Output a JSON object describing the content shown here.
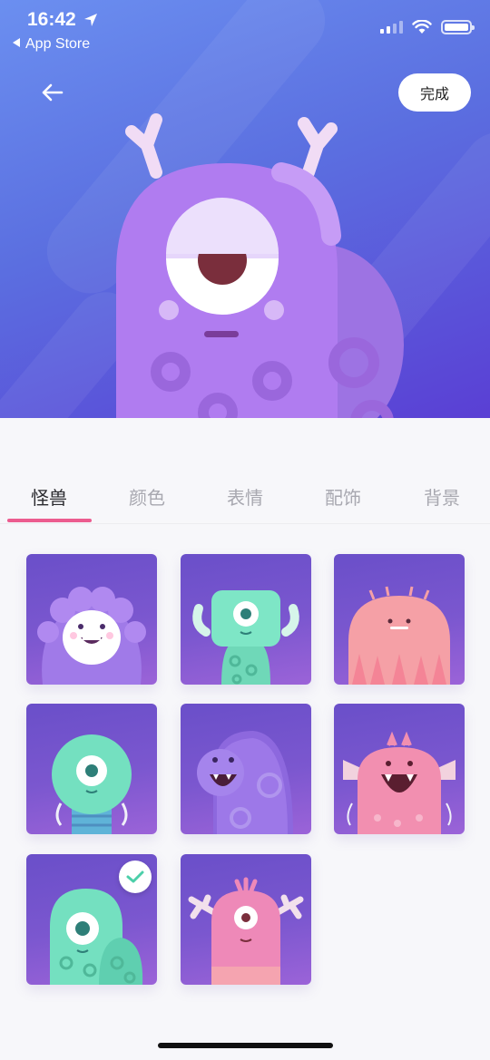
{
  "status_bar": {
    "time": "16:42",
    "back_app": "App Store"
  },
  "header": {
    "done_label": "完成"
  },
  "tabs": [
    {
      "label": "怪兽",
      "active": true
    },
    {
      "label": "颜色",
      "active": false
    },
    {
      "label": "表情",
      "active": false
    },
    {
      "label": "配饰",
      "active": false
    },
    {
      "label": "背景",
      "active": false
    }
  ],
  "monsters": [
    {
      "name": "furry-purple-monster",
      "selected": false
    },
    {
      "name": "block-cyclops-monster",
      "selected": false
    },
    {
      "name": "pink-shaggy-monster",
      "selected": false
    },
    {
      "name": "teal-tentacle-monster",
      "selected": false
    },
    {
      "name": "purple-blob-monster",
      "selected": false
    },
    {
      "name": "pink-horned-monster",
      "selected": false
    },
    {
      "name": "teal-round-monster",
      "selected": true
    },
    {
      "name": "pink-antler-monster",
      "selected": false
    }
  ],
  "colors": {
    "accent": "#ec5c8f",
    "check": "#4ccfa9"
  }
}
